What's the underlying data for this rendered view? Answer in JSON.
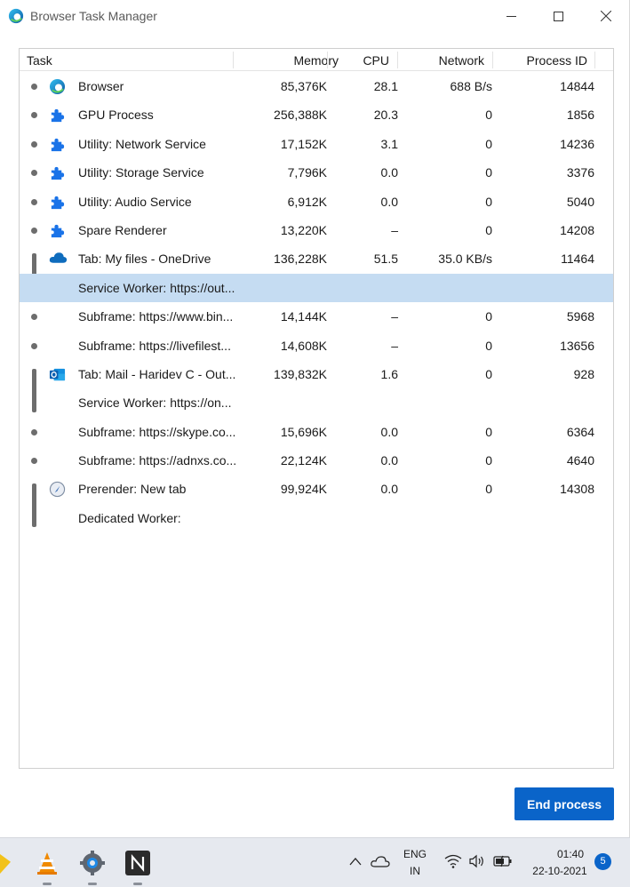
{
  "window": {
    "title": "Browser Task Manager"
  },
  "columns": {
    "task": "Task",
    "memory": "Memory",
    "cpu": "CPU",
    "network": "Network",
    "pid": "Process ID"
  },
  "rows": [
    {
      "name": "Browser",
      "memory": "85,376K",
      "cpu": "28.1",
      "network": "688 B/s",
      "pid": "14844",
      "icon": "edge-icon",
      "group": "dot"
    },
    {
      "name": "GPU Process",
      "memory": "256,388K",
      "cpu": "20.3",
      "network": "0",
      "pid": "1856",
      "icon": "puzzle-icon",
      "group": "dot"
    },
    {
      "name": "Utility: Network Service",
      "memory": "17,152K",
      "cpu": "3.1",
      "network": "0",
      "pid": "14236",
      "icon": "puzzle-icon",
      "group": "dot"
    },
    {
      "name": "Utility: Storage Service",
      "memory": "7,796K",
      "cpu": "0.0",
      "network": "0",
      "pid": "3376",
      "icon": "puzzle-icon",
      "group": "dot"
    },
    {
      "name": "Utility: Audio Service",
      "memory": "6,912K",
      "cpu": "0.0",
      "network": "0",
      "pid": "5040",
      "icon": "puzzle-icon",
      "group": "dot"
    },
    {
      "name": "Spare Renderer",
      "memory": "13,220K",
      "cpu": "–",
      "network": "0",
      "pid": "14208",
      "icon": "puzzle-icon",
      "group": "dot"
    },
    {
      "name": "Tab: My files - OneDrive",
      "memory": "136,228K",
      "cpu": "51.5",
      "network": "35.0 KB/s",
      "pid": "11464",
      "icon": "onedrive-icon",
      "group": "bar-start"
    },
    {
      "name": "Service Worker: https://out...",
      "memory": "",
      "cpu": "",
      "network": "",
      "pid": "",
      "icon": "",
      "group": "bar-end",
      "selected": true
    },
    {
      "name": "Subframe: https://www.bin...",
      "memory": "14,144K",
      "cpu": "–",
      "network": "0",
      "pid": "5968",
      "icon": "",
      "group": "dot"
    },
    {
      "name": "Subframe: https://livefilest...",
      "memory": "14,608K",
      "cpu": "–",
      "network": "0",
      "pid": "13656",
      "icon": "",
      "group": "dot"
    },
    {
      "name": "Tab: Mail - Haridev C - Out...",
      "memory": "139,832K",
      "cpu": "1.6",
      "network": "0",
      "pid": "928",
      "icon": "outlook-icon",
      "group": "bar-start"
    },
    {
      "name": "Service Worker: https://on...",
      "memory": "",
      "cpu": "",
      "network": "",
      "pid": "",
      "icon": "",
      "group": "bar-end"
    },
    {
      "name": "Subframe: https://skype.co...",
      "memory": "15,696K",
      "cpu": "0.0",
      "network": "0",
      "pid": "6364",
      "icon": "",
      "group": "dot"
    },
    {
      "name": "Subframe: https://adnxs.co...",
      "memory": "22,124K",
      "cpu": "0.0",
      "network": "0",
      "pid": "4640",
      "icon": "",
      "group": "dot"
    },
    {
      "name": "Prerender: New tab",
      "memory": "99,924K",
      "cpu": "0.0",
      "network": "0",
      "pid": "14308",
      "icon": "prerender-icon",
      "group": "bar-start"
    },
    {
      "name": "Dedicated Worker:",
      "memory": "",
      "cpu": "",
      "network": "",
      "pid": "",
      "icon": "",
      "group": "bar-end"
    }
  ],
  "actions": {
    "end_process": "End process"
  },
  "taskbar": {
    "lang_line1": "ENG",
    "lang_line2": "IN",
    "time": "01:40",
    "date": "22-10-2021",
    "notifications": "5"
  },
  "colors": {
    "accent": "#0a64c9",
    "selected_row": "#c5dcf2",
    "puzzle": "#1a73e8"
  }
}
